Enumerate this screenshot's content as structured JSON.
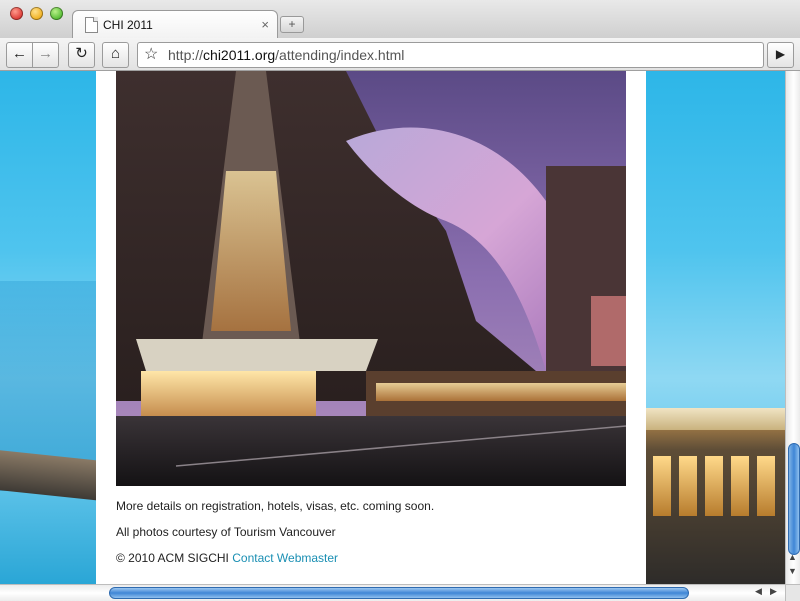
{
  "tab": {
    "title": "CHI 2011",
    "close_glyph": "×",
    "new_tab_glyph": "+"
  },
  "toolbar": {
    "back_glyph": "←",
    "forward_glyph": "→",
    "reload_glyph": "↻",
    "home_glyph": "⌂",
    "star_glyph": "☆",
    "go_glyph": "▶"
  },
  "address": {
    "protocol": "http://",
    "host": "chi2011.org",
    "path": "/attending/index.html"
  },
  "page": {
    "line1": "More details on registration, hotels, visas, etc. coming soon.",
    "line2": "All photos courtesy of Tourism Vancouver",
    "copyright": "© 2010 ACM SIGCHI",
    "contact_link": "Contact Webmaster"
  },
  "colors": {
    "link": "#1a8fb3",
    "background_sky": "#2db6e8",
    "scroll_thumb": "#3f86d6"
  }
}
